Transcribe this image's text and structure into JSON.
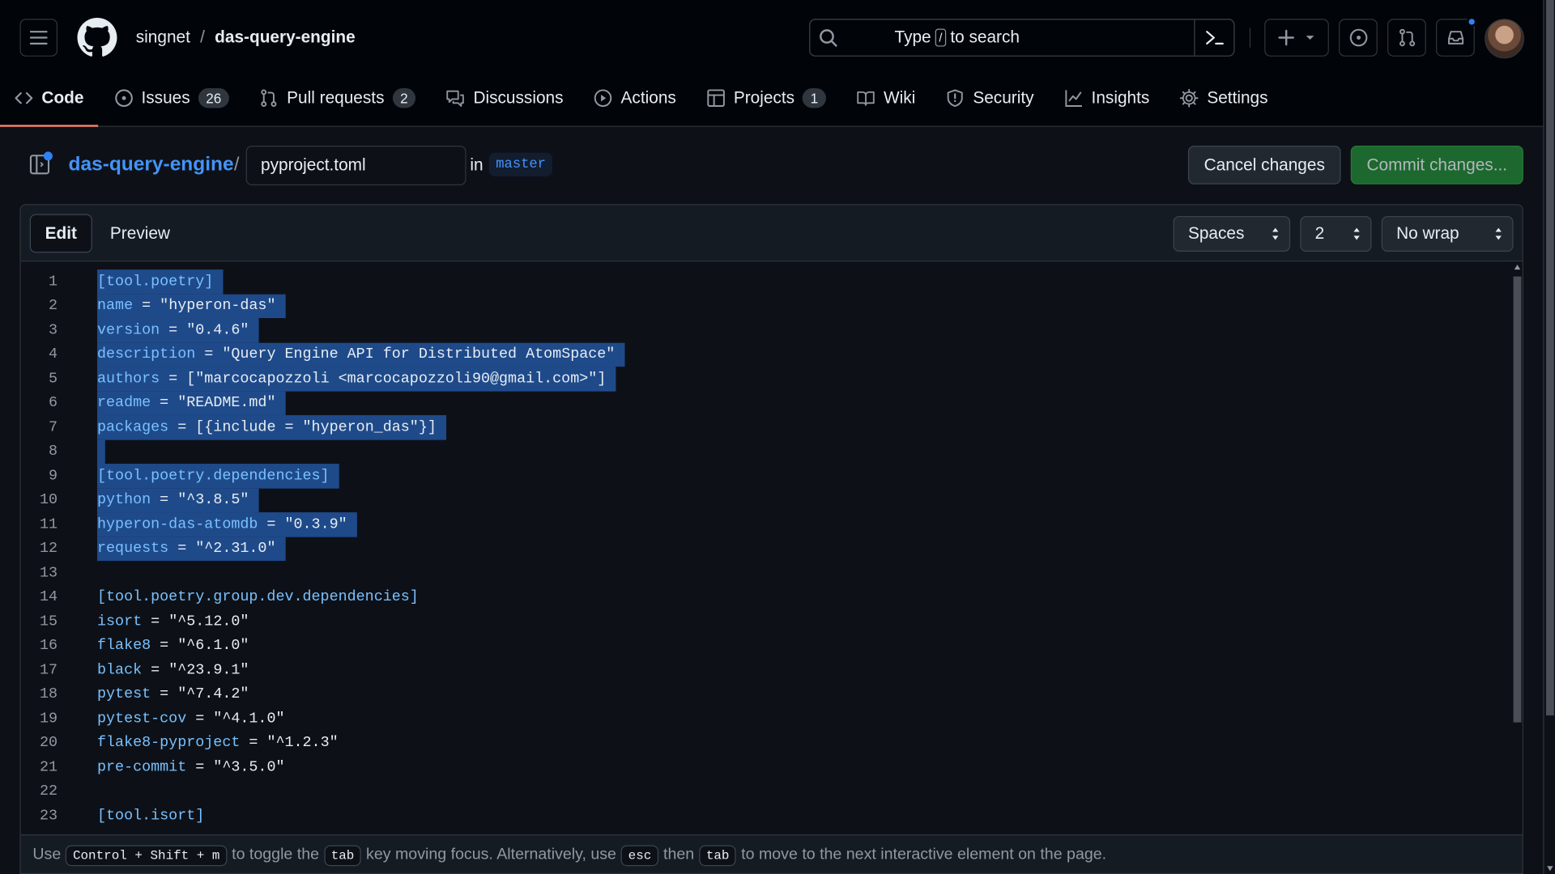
{
  "header": {
    "owner": "singnet",
    "separator": "/",
    "repo": "das-query-engine",
    "search_prefix": "Type",
    "search_key": "/",
    "search_suffix": "to search"
  },
  "tabs": [
    {
      "label": "Code",
      "count": null
    },
    {
      "label": "Issues",
      "count": "26"
    },
    {
      "label": "Pull requests",
      "count": "2"
    },
    {
      "label": "Discussions",
      "count": null
    },
    {
      "label": "Actions",
      "count": null
    },
    {
      "label": "Projects",
      "count": "1"
    },
    {
      "label": "Wiki",
      "count": null
    },
    {
      "label": "Security",
      "count": null
    },
    {
      "label": "Insights",
      "count": null
    },
    {
      "label": "Settings",
      "count": null
    }
  ],
  "pathbar": {
    "repo_link": "das-query-engine",
    "slash": "/",
    "filename": "pyproject.toml",
    "in_label": "in",
    "branch": "master",
    "cancel_label": "Cancel changes",
    "commit_label": "Commit changes..."
  },
  "editor": {
    "edit_label": "Edit",
    "preview_label": "Preview",
    "indent_mode": "Spaces",
    "indent_size": "2",
    "wrap_mode": "No wrap",
    "lines": [
      {
        "n": "1",
        "text": "[tool.poetry]",
        "sel": true
      },
      {
        "n": "2",
        "text": "name = \"hyperon-das\"",
        "sel": true
      },
      {
        "n": "3",
        "text": "version = \"0.4.6\"",
        "sel": true
      },
      {
        "n": "4",
        "text": "description = \"Query Engine API for Distributed AtomSpace\"",
        "sel": true
      },
      {
        "n": "5",
        "text": "authors = [\"marcocapozzoli <marcocapozzoli90@gmail.com>\"]",
        "sel": true
      },
      {
        "n": "6",
        "text": "readme = \"README.md\"",
        "sel": true
      },
      {
        "n": "7",
        "text": "packages = [{include = \"hyperon_das\"}]",
        "sel": true
      },
      {
        "n": "8",
        "text": "",
        "sel": true
      },
      {
        "n": "9",
        "text": "[tool.poetry.dependencies]",
        "sel": true
      },
      {
        "n": "10",
        "text": "python = \"^3.8.5\"",
        "sel": true
      },
      {
        "n": "11",
        "text": "hyperon-das-atomdb = \"0.3.9\"",
        "sel": true
      },
      {
        "n": "12",
        "text": "requests = \"^2.31.0\"",
        "sel": true
      },
      {
        "n": "13",
        "text": "",
        "sel": false
      },
      {
        "n": "14",
        "text": "[tool.poetry.group.dev.dependencies]",
        "sel": false
      },
      {
        "n": "15",
        "text": "isort = \"^5.12.0\"",
        "sel": false
      },
      {
        "n": "16",
        "text": "flake8 = \"^6.1.0\"",
        "sel": false
      },
      {
        "n": "17",
        "text": "black = \"^23.9.1\"",
        "sel": false
      },
      {
        "n": "18",
        "text": "pytest = \"^7.4.2\"",
        "sel": false
      },
      {
        "n": "19",
        "text": "pytest-cov = \"^4.1.0\"",
        "sel": false
      },
      {
        "n": "20",
        "text": "flake8-pyproject = \"^1.2.3\"",
        "sel": false
      },
      {
        "n": "21",
        "text": "pre-commit = \"^3.5.0\"",
        "sel": false
      },
      {
        "n": "22",
        "text": "",
        "sel": false
      },
      {
        "n": "23",
        "text": "[tool.isort]",
        "sel": false
      }
    ]
  },
  "help": {
    "p1": "Use",
    "k1": "Control + Shift + m",
    "p2": "to toggle the",
    "k2": "tab",
    "p3": "key moving focus. Alternatively, use",
    "k3": "esc",
    "p4": "then",
    "k4": "tab",
    "p5": "to move to the next interactive element on the page."
  },
  "colors": {
    "accent": "#4493f8",
    "commit_green": "#238636",
    "selection": "#1f4a8a",
    "tab_underline": "#f78166"
  }
}
